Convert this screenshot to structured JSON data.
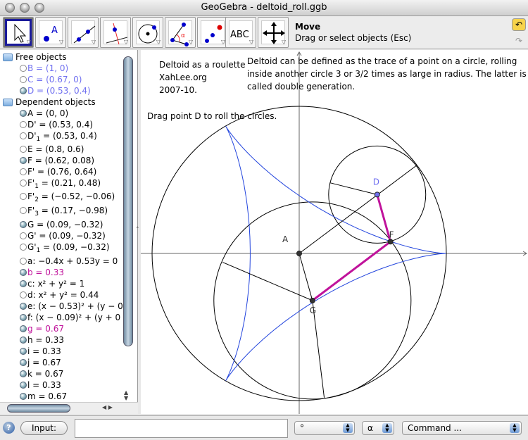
{
  "window": {
    "title": "GeoGebra - deltoid_roll.ggb"
  },
  "toolbar": {
    "tools": [
      {
        "name": "move",
        "icon": "arrow-cursor-icon"
      },
      {
        "name": "new-point",
        "icon": "point-icon"
      },
      {
        "name": "line-through-two-points",
        "icon": "line-icon"
      },
      {
        "name": "perpendicular-line",
        "icon": "perpendicular-line-icon"
      },
      {
        "name": "circle-center-point",
        "icon": "circle-icon"
      },
      {
        "name": "angle",
        "icon": "angle-icon"
      },
      {
        "name": "reflect-about-point",
        "icon": "reflect-point-icon"
      },
      {
        "name": "insert-text",
        "icon": "text-icon",
        "label": "ABC"
      },
      {
        "name": "move-graphics-view",
        "icon": "move-view-icon"
      }
    ],
    "selected_tool": "Move",
    "selected_help": "Drag or select objects (Esc)"
  },
  "algebra": {
    "free_label": "Free objects",
    "dependent_label": "Dependent objects",
    "free": [
      {
        "pre": "B = (1, 0)",
        "sub": "",
        "post": "",
        "shown": false,
        "color": "#7070f0"
      },
      {
        "pre": "C = (0.67, 0)",
        "sub": "",
        "post": "",
        "shown": false,
        "color": "#7070f0"
      },
      {
        "pre": "D = (0.53, 0.4)",
        "sub": "",
        "post": "",
        "shown": true,
        "color": "#7070f0"
      }
    ],
    "dependent": [
      {
        "pre": "A = (0, 0)",
        "sub": "",
        "post": "",
        "shown": true
      },
      {
        "pre": "D' = (0.53, 0.4)",
        "sub": "",
        "post": "",
        "shown": false
      },
      {
        "pre": "D'",
        "sub": "1",
        "post": " = (0.53, 0.4)",
        "shown": false
      },
      {
        "pre": "E = (0.8, 0.6)",
        "sub": "",
        "post": "",
        "shown": false
      },
      {
        "pre": "F = (0.62, 0.08)",
        "sub": "",
        "post": "",
        "shown": true
      },
      {
        "pre": "F' = (0.76, 0.64)",
        "sub": "",
        "post": "",
        "shown": false
      },
      {
        "pre": "F'",
        "sub": "1",
        "post": " = (0.21, 0.48)",
        "shown": false
      },
      {
        "pre": "F'",
        "sub": "2",
        "post": " = (−0.52, −0.06)",
        "shown": false
      },
      {
        "pre": "F'",
        "sub": "3",
        "post": " = (0.17, −0.98)",
        "shown": false
      },
      {
        "pre": "G = (0.09, −0.32)",
        "sub": "",
        "post": "",
        "shown": true
      },
      {
        "pre": "G' = (0.09, −0.32)",
        "sub": "",
        "post": "",
        "shown": false
      },
      {
        "pre": "G'",
        "sub": "1",
        "post": " = (0.09, −0.32)",
        "shown": false
      },
      {
        "pre": "a: −0.4x + 0.53y = 0",
        "sub": "",
        "post": "",
        "shown": false
      },
      {
        "pre": "b = 0.33",
        "sub": "",
        "post": "",
        "shown": true,
        "color": "#c0139b"
      },
      {
        "pre": "c: x² + y² = 1",
        "sub": "",
        "post": "",
        "shown": true
      },
      {
        "pre": "d: x² + y² = 0.44",
        "sub": "",
        "post": "",
        "shown": false
      },
      {
        "pre": "e: (x − 0.53)² + (y − 0",
        "sub": "",
        "post": "",
        "shown": true
      },
      {
        "pre": "f: (x − 0.09)² + (y + 0",
        "sub": "",
        "post": "",
        "shown": true
      },
      {
        "pre": "g = 0.67",
        "sub": "",
        "post": "",
        "shown": true,
        "color": "#c0139b"
      },
      {
        "pre": "h = 0.33",
        "sub": "",
        "post": "",
        "shown": true
      },
      {
        "pre": "i = 0.33",
        "sub": "",
        "post": "",
        "shown": true
      },
      {
        "pre": "j = 0.67",
        "sub": "",
        "post": "",
        "shown": true
      },
      {
        "pre": "k = 0.67",
        "sub": "",
        "post": "",
        "shown": true
      },
      {
        "pre": "l = 0.33",
        "sub": "",
        "post": "",
        "shown": true
      },
      {
        "pre": "m = 0.67",
        "sub": "",
        "post": "",
        "shown": true
      }
    ]
  },
  "graphics": {
    "text1": [
      "Deltoid as a roulette",
      "XahLee.org",
      "2007-10."
    ],
    "text2": [
      "Deltoid can be defined as the trace of a point on a circle, rolling",
      "inside another circle 3 or 3/2 times as large in radius. The latter is",
      "called double generation."
    ],
    "text3": "Drag point D to roll the circles.",
    "points": {
      "A": [
        0,
        0
      ],
      "D": [
        0.53,
        0.4
      ],
      "E": [
        0.8,
        0.6
      ],
      "F": [
        0.62,
        0.08
      ],
      "G": [
        0.09,
        -0.32
      ],
      "F1": [
        0.21,
        0.48
      ],
      "F2": [
        -0.52,
        -0.06
      ],
      "F3": [
        0.17,
        -0.98
      ]
    },
    "labels": {
      "A": "A",
      "D": "D",
      "F": "F",
      "G": "G"
    },
    "circles": {
      "c": {
        "center": [
          0,
          0
        ],
        "r": 1
      },
      "e": {
        "center": [
          0.53,
          0.4
        ],
        "r": 0.33
      },
      "f": {
        "center": [
          0.09,
          -0.32
        ],
        "r": 0.67
      }
    },
    "deltoid_rolling_radius": 0.333,
    "colors": {
      "curve": "#2244dd",
      "segment": "#c0139b",
      "free_point": "#7070f0",
      "dependent_point": "#333333"
    }
  },
  "input": {
    "help_icon": "?",
    "label": "Input:",
    "value": "",
    "degree": "°",
    "alpha": "α",
    "command": "Command ..."
  }
}
